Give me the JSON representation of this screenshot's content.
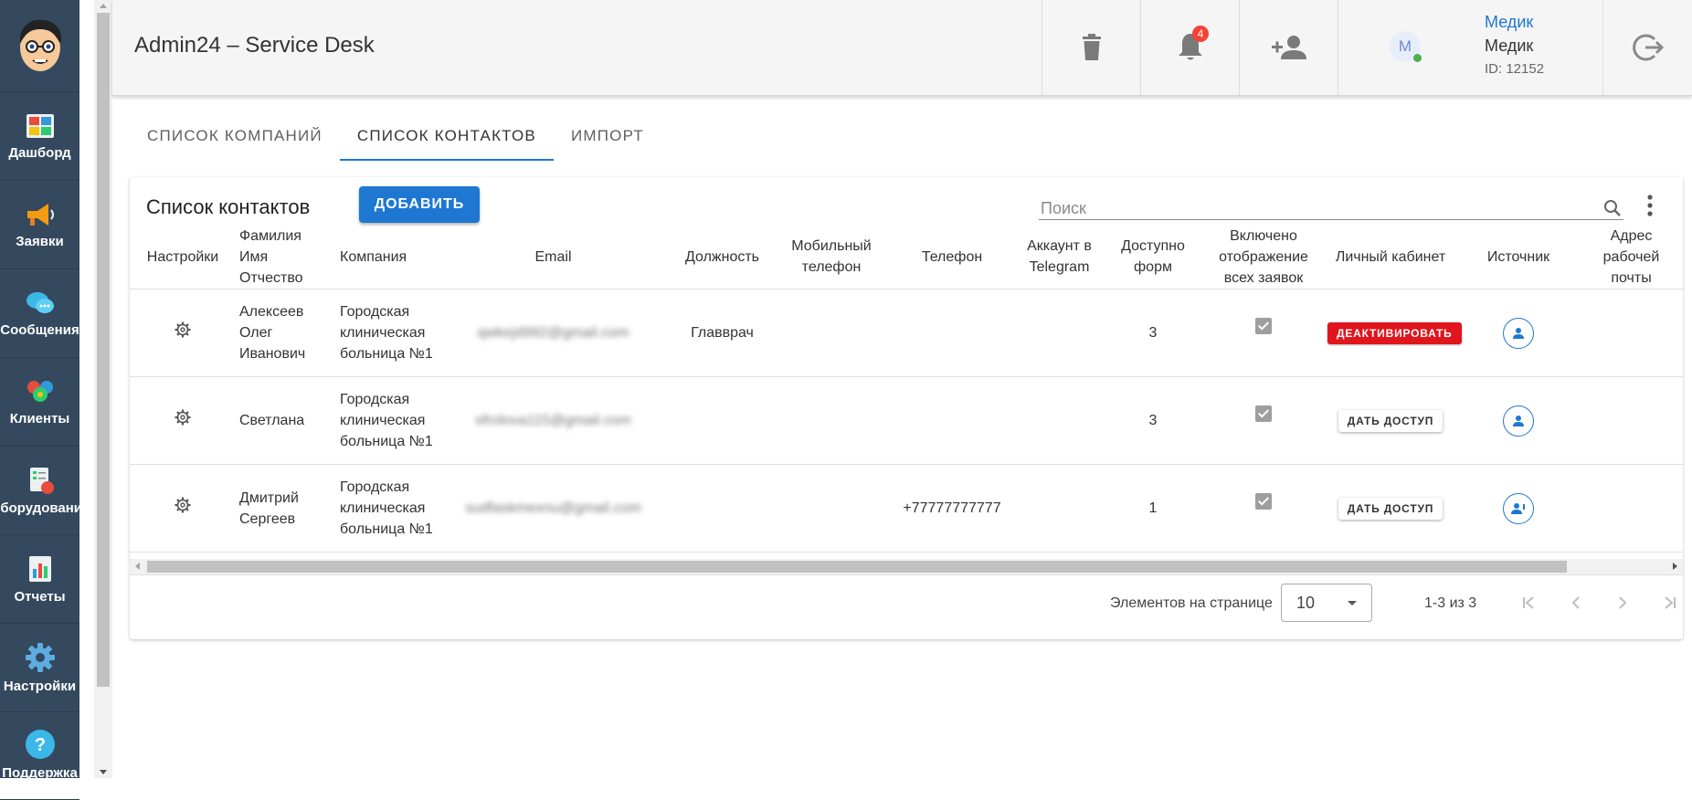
{
  "sidebar": {
    "items": [
      {
        "label": "Дашборд",
        "icon": "dashboard-icon"
      },
      {
        "label": "Заявки",
        "icon": "megaphone-icon"
      },
      {
        "label": "Сообщения",
        "icon": "chat-icon"
      },
      {
        "label": "Клиенты",
        "icon": "clients-icon"
      },
      {
        "label": "Оборудование",
        "icon": "equipment-icon"
      },
      {
        "label": "Отчеты",
        "icon": "reports-icon"
      },
      {
        "label": "Настройки",
        "icon": "gear-icon"
      },
      {
        "label": "Поддержка",
        "icon": "help-icon"
      }
    ]
  },
  "header": {
    "title": "Admin24 – Service Desk",
    "notification_count": "4",
    "user": {
      "avatar_letter": "M",
      "link": "Медик",
      "name": "Медик",
      "id": "ID: 12152"
    }
  },
  "tabs": [
    {
      "label": "СПИСОК КОМПАНИЙ",
      "active": false
    },
    {
      "label": "СПИСОК КОНТАКТОВ",
      "active": true
    },
    {
      "label": "ИМПОРТ",
      "active": false
    }
  ],
  "card": {
    "title": "Список контактов",
    "add_label": "ДОБАВИТЬ",
    "search_placeholder": "Поиск"
  },
  "table": {
    "columns": [
      "Настройки",
      "Фамилия Имя Отчество",
      "Компания",
      "Email",
      "Должность",
      "Мобильный телефон",
      "Телефон",
      "Аккаунт в Telegram",
      "Доступно форм",
      "Включено отображение всех заявок",
      "Личный кабинет",
      "Источник",
      "Адрес рабочей почты"
    ],
    "rows": [
      {
        "name": "Алексеев Олег Иванович",
        "company": "Городская клиническая больница №1",
        "email": "qwkejd992@gmail.com",
        "position": "Главврач",
        "mobile": "",
        "phone": "",
        "telegram": "",
        "forms": "3",
        "show_all": true,
        "cabinet": "ДЕАКТИВИРОВАТЬ",
        "cabinet_type": "deactivate"
      },
      {
        "name": "Светлана",
        "company": "Городская клиническая больница №1",
        "email": "sfrolova115@gmail.com",
        "position": "",
        "mobile": "",
        "phone": "",
        "telegram": "",
        "forms": "3",
        "show_all": true,
        "cabinet": "ДАТЬ ДОСТУП",
        "cabinet_type": "grant"
      },
      {
        "name": "Дмитрий Сергеев",
        "company": "Городская клиническая больница №1",
        "email": "sudfaskmexnu@gmail.com",
        "position": "",
        "mobile": "",
        "phone": "+77777777777",
        "telegram": "",
        "forms": "1",
        "show_all": true,
        "cabinet": "ДАТЬ ДОСТУП",
        "cabinet_type": "grant"
      }
    ]
  },
  "pagination": {
    "per_page_label": "Элементов на странице",
    "per_page": "10",
    "range": "1-3 из 3"
  },
  "colors": {
    "sidebar": "#34495e",
    "accent": "#1e78d2",
    "danger": "#e0151d"
  }
}
